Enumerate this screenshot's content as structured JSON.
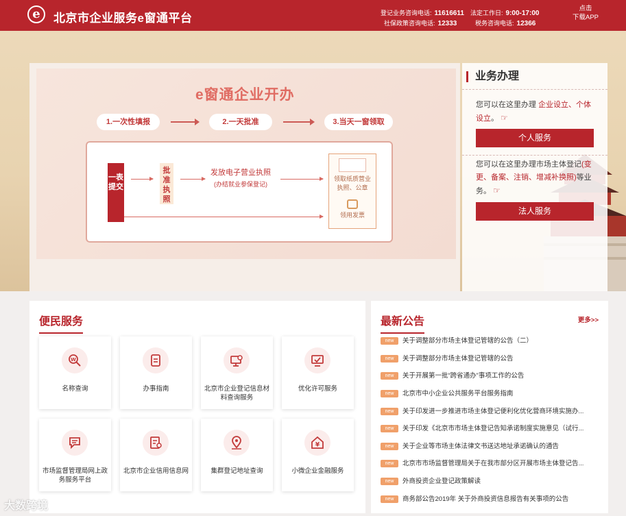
{
  "header": {
    "logo_letter": "e",
    "title": "北京市企业服务e窗通平台",
    "hotlines": [
      {
        "label": "登记业务咨询电话:",
        "number": "11616611"
      },
      {
        "label": "法定工作日:",
        "number": "9:00-17:00"
      },
      {
        "label": "社保政策咨询电话:",
        "number": "12333"
      },
      {
        "label": "税务咨询电话:",
        "number": "12366"
      }
    ],
    "app_line1": "点击",
    "app_line2": "下载APP"
  },
  "banner": {
    "title": "e窗通企业开办",
    "steps": [
      "1.一次性填报",
      "2.一天批准",
      "3.当天一窗领取"
    ],
    "submit_box": "一表提交",
    "approve_box": "批准执照",
    "issue_line1": "发放电子营业执照",
    "issue_line2": "(办结就业参保登记)",
    "receive_line1": "领取纸质营业",
    "receive_line2": "执照、公章",
    "receive_invoice": "领用发票"
  },
  "business": {
    "title": "业务办理",
    "personal_desc_prefix": "您可以在这里办理 ",
    "personal_desc_highlight": "企业设立、个体设立",
    "personal_desc_suffix": "。",
    "personal_button": "个人服务",
    "legal_desc_prefix": "您可以在这里办理市场主体登记",
    "legal_desc_highlight": "(变更、备案、注销、增减补换照)",
    "legal_desc_suffix": "等业务。",
    "legal_button": "法人服务"
  },
  "services": {
    "title": "便民服务",
    "items": [
      {
        "label": "名称查询",
        "icon": "name-search-icon"
      },
      {
        "label": "办事指南",
        "icon": "guide-book-icon"
      },
      {
        "label": "北京市企业登记信息材料查询服务",
        "icon": "registration-query-icon"
      },
      {
        "label": "优化许可服务",
        "icon": "license-monitor-icon"
      },
      {
        "label": "市场监督管理局网上政务服务平台",
        "icon": "chat-bubble-icon"
      },
      {
        "label": "北京市企业信用信息网",
        "icon": "credit-document-icon"
      },
      {
        "label": "集群登记地址查询",
        "icon": "location-pin-icon"
      },
      {
        "label": "小微企业金融服务",
        "icon": "yuan-house-icon"
      }
    ]
  },
  "announcements": {
    "title": "最新公告",
    "more_label": "更多>>",
    "badge": "new",
    "items": [
      "关于调整部分市场主体登记管辖的公告（二）",
      "关于调整部分市场主体登记管辖的公告",
      "关于开展第一批“跨省通办”事项工作的公告",
      "北京市中小企业公共服务平台服务指南",
      "关于印发进一步推进市场主体登记便利化优化营商环境实施办...",
      "关于印发《北京市市场主体登记告知承诺制度实施意见（试行...",
      "关于企业等市场主体法律文书送达地址承诺确认的通告",
      "北京市市场监督管理局关于在我市部分区开展市场主体登记告...",
      "外商投资企业登记政策解读",
      "商务部公告2019年 关于外商投资信息报告有关事项的公告"
    ]
  },
  "watermark": "大数跨境",
  "colors": {
    "brand_red": "#b8252c",
    "badge_orange": "#f0a06a"
  }
}
